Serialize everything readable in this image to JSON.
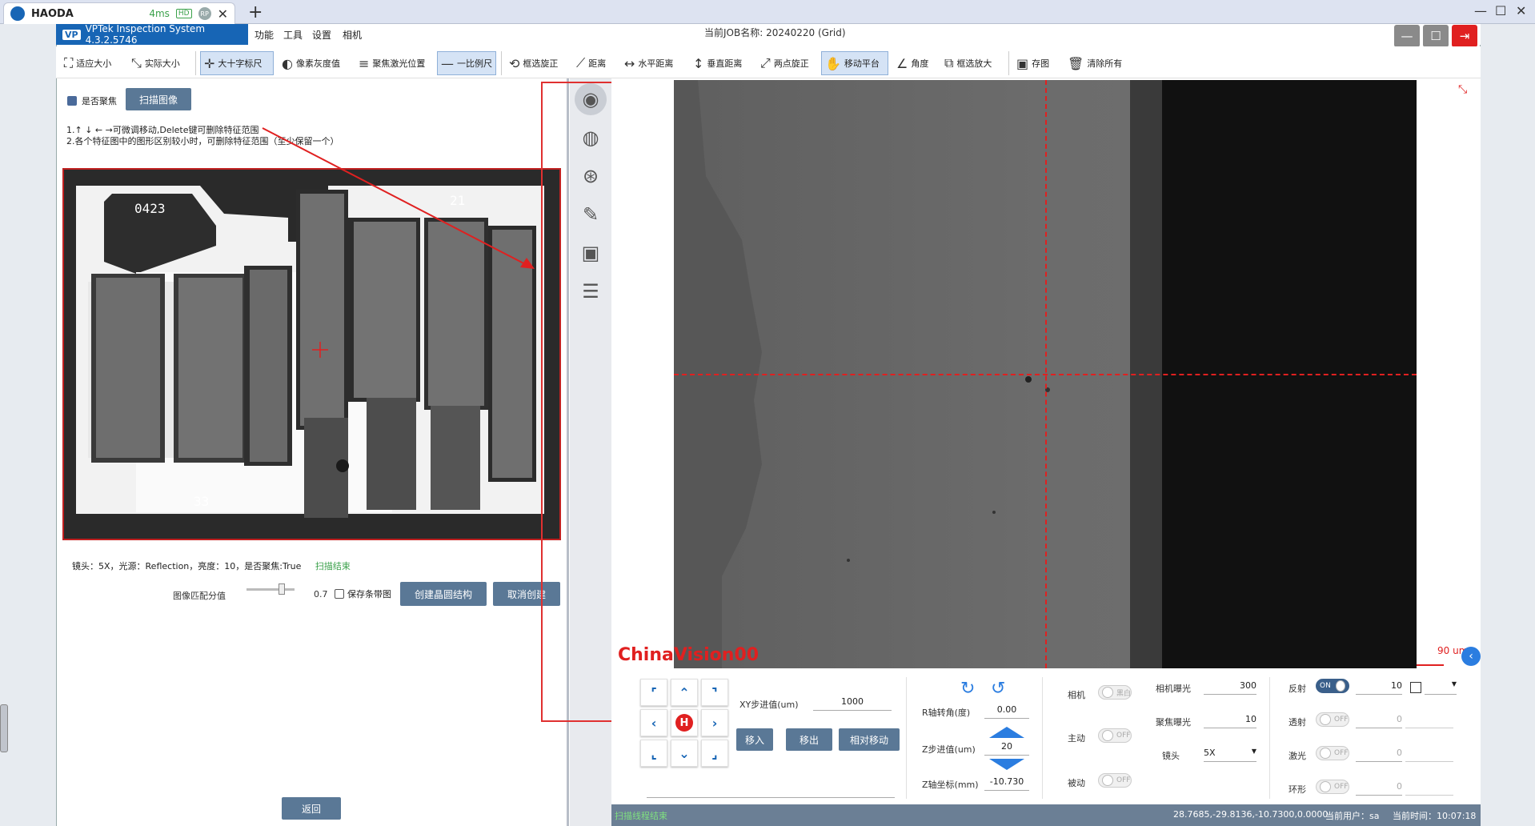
{
  "browser": {
    "tab_title": "HAODA",
    "latency": "4ms",
    "hd_badge": "HD",
    "rp_badge": "RP",
    "close": "✕",
    "new_tab": "+",
    "min": "—",
    "max": "☐",
    "close_win": "✕"
  },
  "app": {
    "brand_logo": "VP",
    "brand": "VPTek Inspection System 4.3.2.5746",
    "menu": [
      "功能",
      "工具",
      "设置",
      "相机"
    ],
    "job_name": "当前JOB名称: 20240220 (Grid)"
  },
  "toolbar": [
    {
      "label": "适应大小",
      "icon": "⛶"
    },
    {
      "label": "实际大小",
      "icon": "⤡"
    },
    {
      "label": "大十字标尺",
      "icon": "✛",
      "active": true
    },
    {
      "label": "像素灰度值",
      "icon": "◐"
    },
    {
      "label": "聚焦激光位置",
      "icon": "≡"
    },
    {
      "label": "一比例尺",
      "icon": "—",
      "active": true
    },
    {
      "label": "框选旋正",
      "icon": "⟲"
    },
    {
      "label": "距离",
      "icon": "⟋"
    },
    {
      "label": "水平距离",
      "icon": "↔"
    },
    {
      "label": "垂直距离",
      "icon": "↕"
    },
    {
      "label": "两点旋正",
      "icon": "⤢"
    },
    {
      "label": "移动平台",
      "icon": "✋",
      "active": true
    },
    {
      "label": "角度",
      "icon": "∠"
    },
    {
      "label": "框选放大",
      "icon": "⧉"
    },
    {
      "label": "存图",
      "icon": "▣"
    },
    {
      "label": "清除所有",
      "icon": "🗑"
    }
  ],
  "left": {
    "focus_label": "是否聚焦",
    "scan_button": "扫描图像",
    "instr1": "1.↑ ↓ ← →可微调移动,Delete键可删除特征范围",
    "instr2": "2.各个特征图中的图形区别较小时，可删除特征范围（至少保留一个）",
    "chip_label_a": "0423",
    "chip_label_b": "21",
    "chip_label_c": "33",
    "status_text": "镜头：5X，光源：Reflection，亮度：10，是否聚焦:True",
    "status_link": "扫描结束",
    "match_label": "图像匹配分值",
    "match_value": "0.7",
    "save_strip_label": "保存条带图",
    "create_button": "创建晶圆结构",
    "cancel_button": "取消创建",
    "back_button": "返回"
  },
  "camera": {
    "scale_label": "90 um",
    "watermark": "ChinaVision00"
  },
  "bottom": {
    "xy_step_label": "XY步进值(um)",
    "xy_step_value": "1000",
    "move_in": "移入",
    "move_out": "移出",
    "relative_move": "相对移动",
    "r_angle_label": "R轴转角(度)",
    "r_angle_value": "0.00",
    "z_step_label": "Z步进值(um)",
    "z_step_value": "20",
    "z_coord_label": "Z轴坐标(mm)",
    "z_coord_value": "-10.730",
    "camera_label": "相机",
    "camera_toggle": "黑白",
    "active_label": "主动",
    "passive_label": "被动",
    "off": "OFF",
    "on": "ON",
    "cam_exposure_label": "相机曝光",
    "cam_exposure_value": "300",
    "focus_exposure_label": "聚焦曝光",
    "focus_exposure_value": "10",
    "lens_label": "镜头",
    "lens_value": "5X",
    "reflect_label": "反射",
    "reflect_value": "10",
    "trans_label": "透射",
    "trans_value": "0",
    "laser_label": "激光",
    "laser_value": "0",
    "ring_label": "环形",
    "ring_value": "0",
    "home_label": "H"
  },
  "statusbar": {
    "left": "扫描线程结束",
    "coords": "28.7685,-29.8136,-10.7300,0.0000",
    "user": "当前用户：sa",
    "time": "当前时间：10:07:18"
  }
}
